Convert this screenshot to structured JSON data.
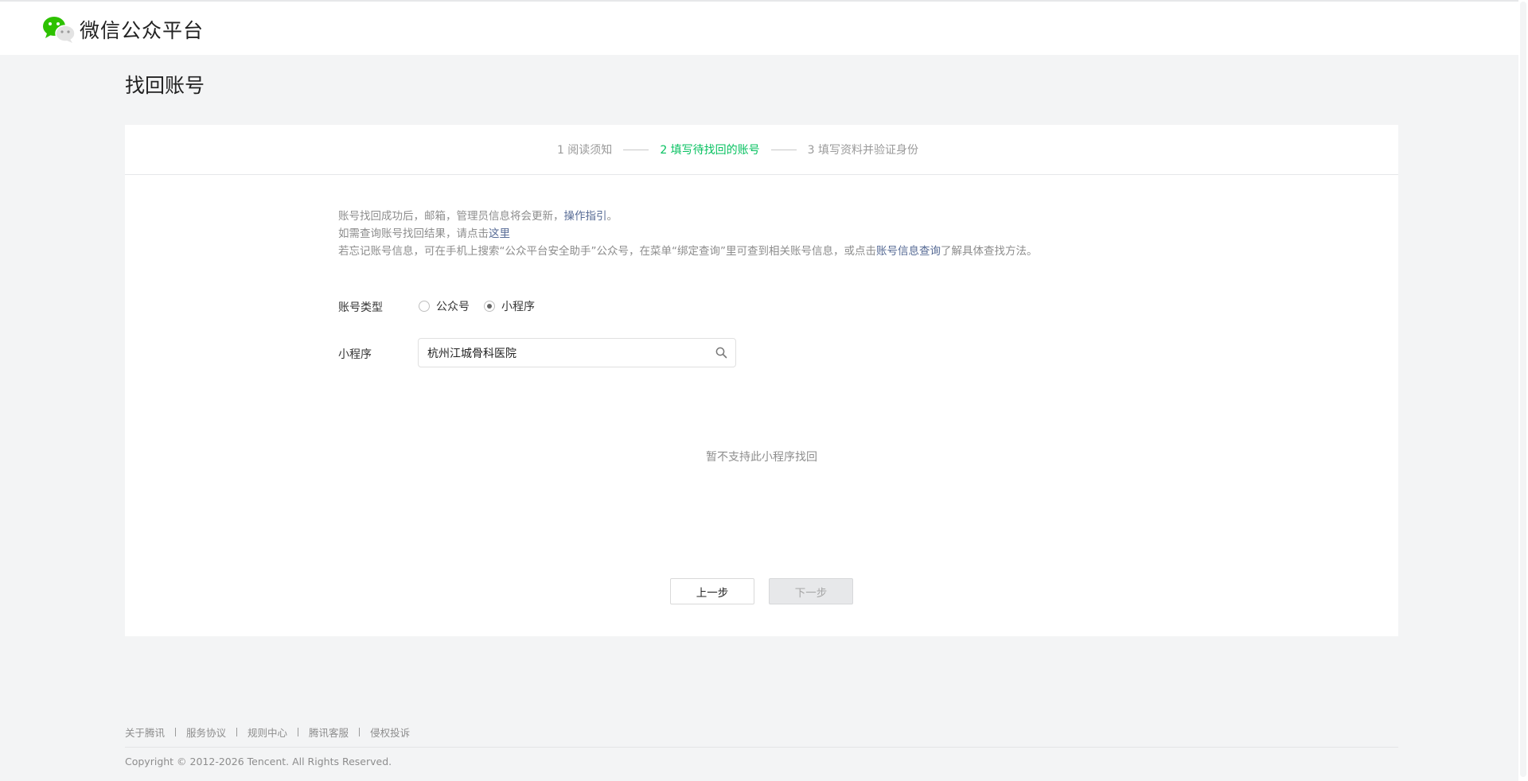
{
  "header": {
    "brand": "微信公众平台"
  },
  "page": {
    "title": "找回账号"
  },
  "steps": [
    {
      "label": "1 阅读须知",
      "active": false
    },
    {
      "label": "2 填写待找回的账号",
      "active": true
    },
    {
      "label": "3 填写资料并验证身份",
      "active": false
    }
  ],
  "notes": {
    "line1_prefix": "账号找回成功后，邮箱，管理员信息将会更新，",
    "line1_link": "操作指引",
    "line1_suffix": "。",
    "line2_prefix": "如需查询账号找回结果，请点击",
    "line2_link": "这里",
    "line3_prefix": "若忘记账号信息，可在手机上搜索“公众平台安全助手”公众号，在菜单“绑定查询”里可查到相关账号信息，或点击",
    "line3_link": "账号信息查询",
    "line3_suffix": "了解具体查找方法。"
  },
  "form": {
    "account_type_label": "账号类型",
    "options": [
      {
        "label": "公众号",
        "checked": false
      },
      {
        "label": "小程序",
        "checked": true
      }
    ],
    "miniprogram_label": "小程序",
    "search_value": "杭州江城骨科医院",
    "empty_tip": "暂不支持此小程序找回"
  },
  "buttons": {
    "prev": "上一步",
    "next": "下一步"
  },
  "footer": {
    "links": [
      "关于腾讯",
      "服务协议",
      "规则中心",
      "腾讯客服",
      "侵权投诉"
    ],
    "copyright": "Copyright © 2012-2026 Tencent. All Rights Reserved."
  },
  "colors": {
    "brand_green": "#07c160",
    "link_blue": "#576b95",
    "background": "#f3f4f5"
  }
}
